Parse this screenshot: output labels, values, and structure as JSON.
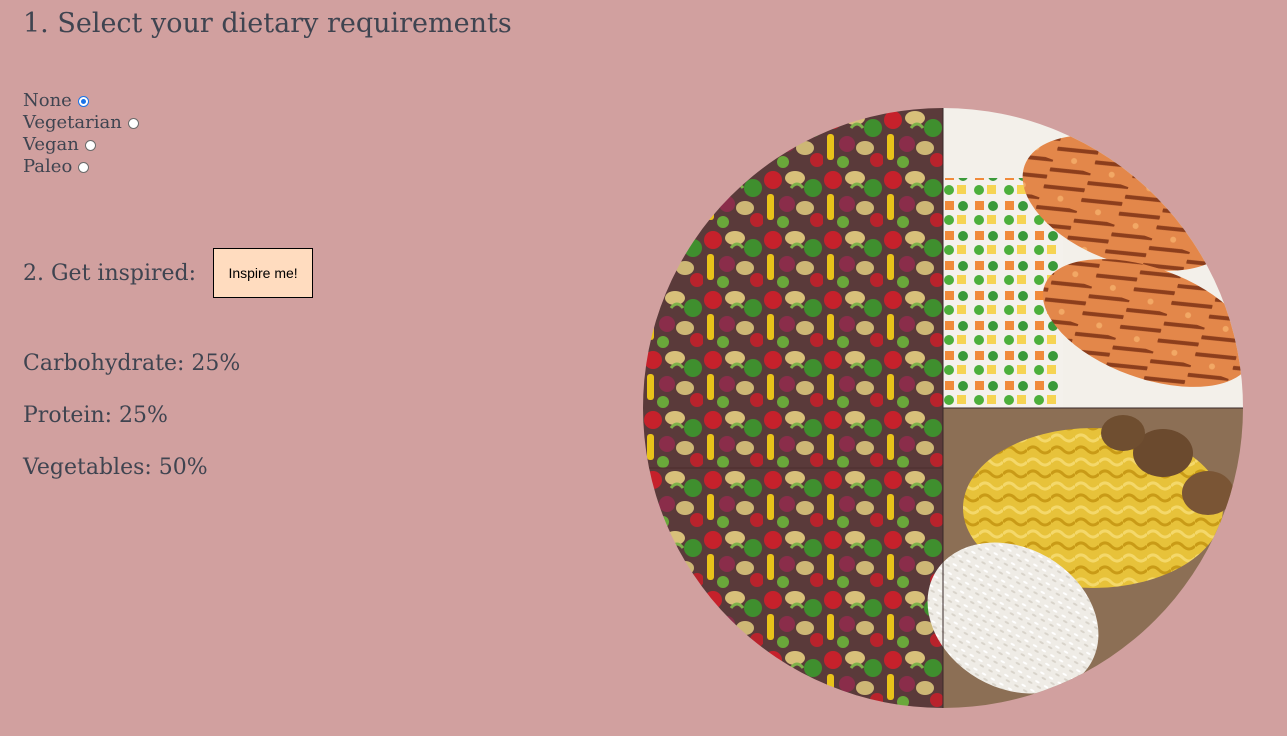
{
  "step1": {
    "title": "1. Select your dietary requirements",
    "options": [
      {
        "label": "None",
        "checked": true
      },
      {
        "label": "Vegetarian",
        "checked": false
      },
      {
        "label": "Vegan",
        "checked": false
      },
      {
        "label": "Paleo",
        "checked": false
      }
    ]
  },
  "step2": {
    "label": "2. Get inspired:",
    "button_label": "Inspire me!"
  },
  "macros": {
    "carbohydrate": "Carbohydrate: 25%",
    "protein": "Protein: 25%",
    "vegetables": "Vegetables: 50%"
  },
  "colors": {
    "background": "#d1a09f",
    "button": "#ffdcbf",
    "text": "#3f4450",
    "radio_selected": "#1a73e8"
  }
}
